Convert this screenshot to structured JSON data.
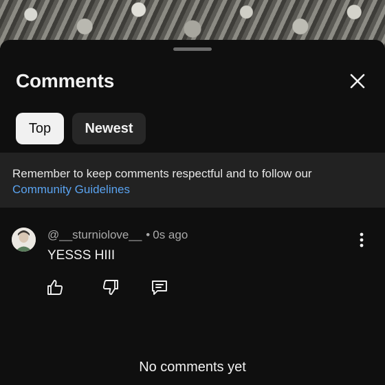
{
  "header": {
    "title": "Comments",
    "close_icon": "close-icon"
  },
  "sort": {
    "tabs": [
      {
        "label": "Top",
        "selected": true
      },
      {
        "label": "Newest",
        "selected": false
      }
    ]
  },
  "notice": {
    "text": "Remember to keep comments respectful and to follow our",
    "link_text": "Community Guidelines"
  },
  "comments": [
    {
      "author": "@__sturniolove__",
      "separator": "•",
      "time": "0s ago",
      "text": "YESSS HIII",
      "actions": [
        "thumbs-up-icon",
        "thumbs-down-icon",
        "reply-icon"
      ]
    }
  ],
  "empty_state": {
    "text": "No comments yet"
  },
  "colors": {
    "background": "#0f0f0f",
    "notice_background": "#222222",
    "link": "#5aa3f0",
    "chip_selected": "#f1f1f1",
    "chip_unselected": "#272727"
  }
}
